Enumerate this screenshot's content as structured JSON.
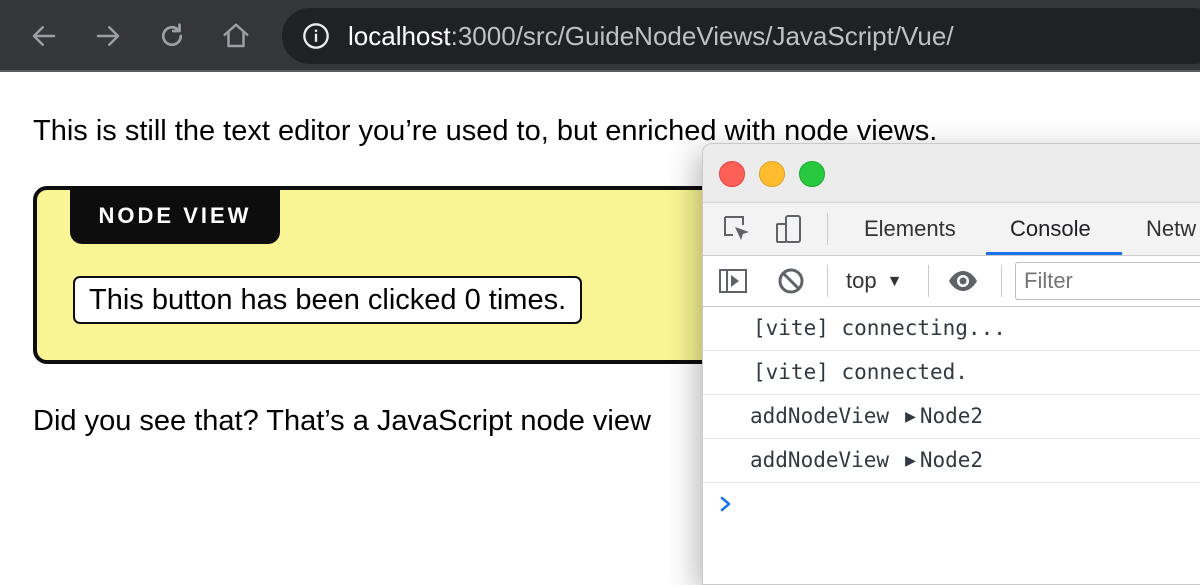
{
  "browser": {
    "url_host": "localhost",
    "url_rest": ":3000/src/GuideNodeViews/JavaScript/Vue/"
  },
  "content": {
    "intro_text": "This is still the text editor you’re used to, but enriched with node views.",
    "node_view_label": "NODE VIEW",
    "node_view_button": "This button has been clicked 0 times.",
    "outro_text": "Did you see that? That’s a JavaScript node view"
  },
  "devtools": {
    "tabs": [
      "Elements",
      "Console",
      "Netw"
    ],
    "active_tab": "Console",
    "context": "top",
    "filter_placeholder": "Filter",
    "console_messages": [
      {
        "text": "[vite] connecting..."
      },
      {
        "text": "[vite] connected."
      },
      {
        "text": "addNodeView",
        "object": "Node2"
      },
      {
        "text": "addNodeView",
        "object": "Node2"
      }
    ]
  },
  "colors": {
    "node_view_bg": "#faf594",
    "accent_blue": "#1a73e8"
  }
}
